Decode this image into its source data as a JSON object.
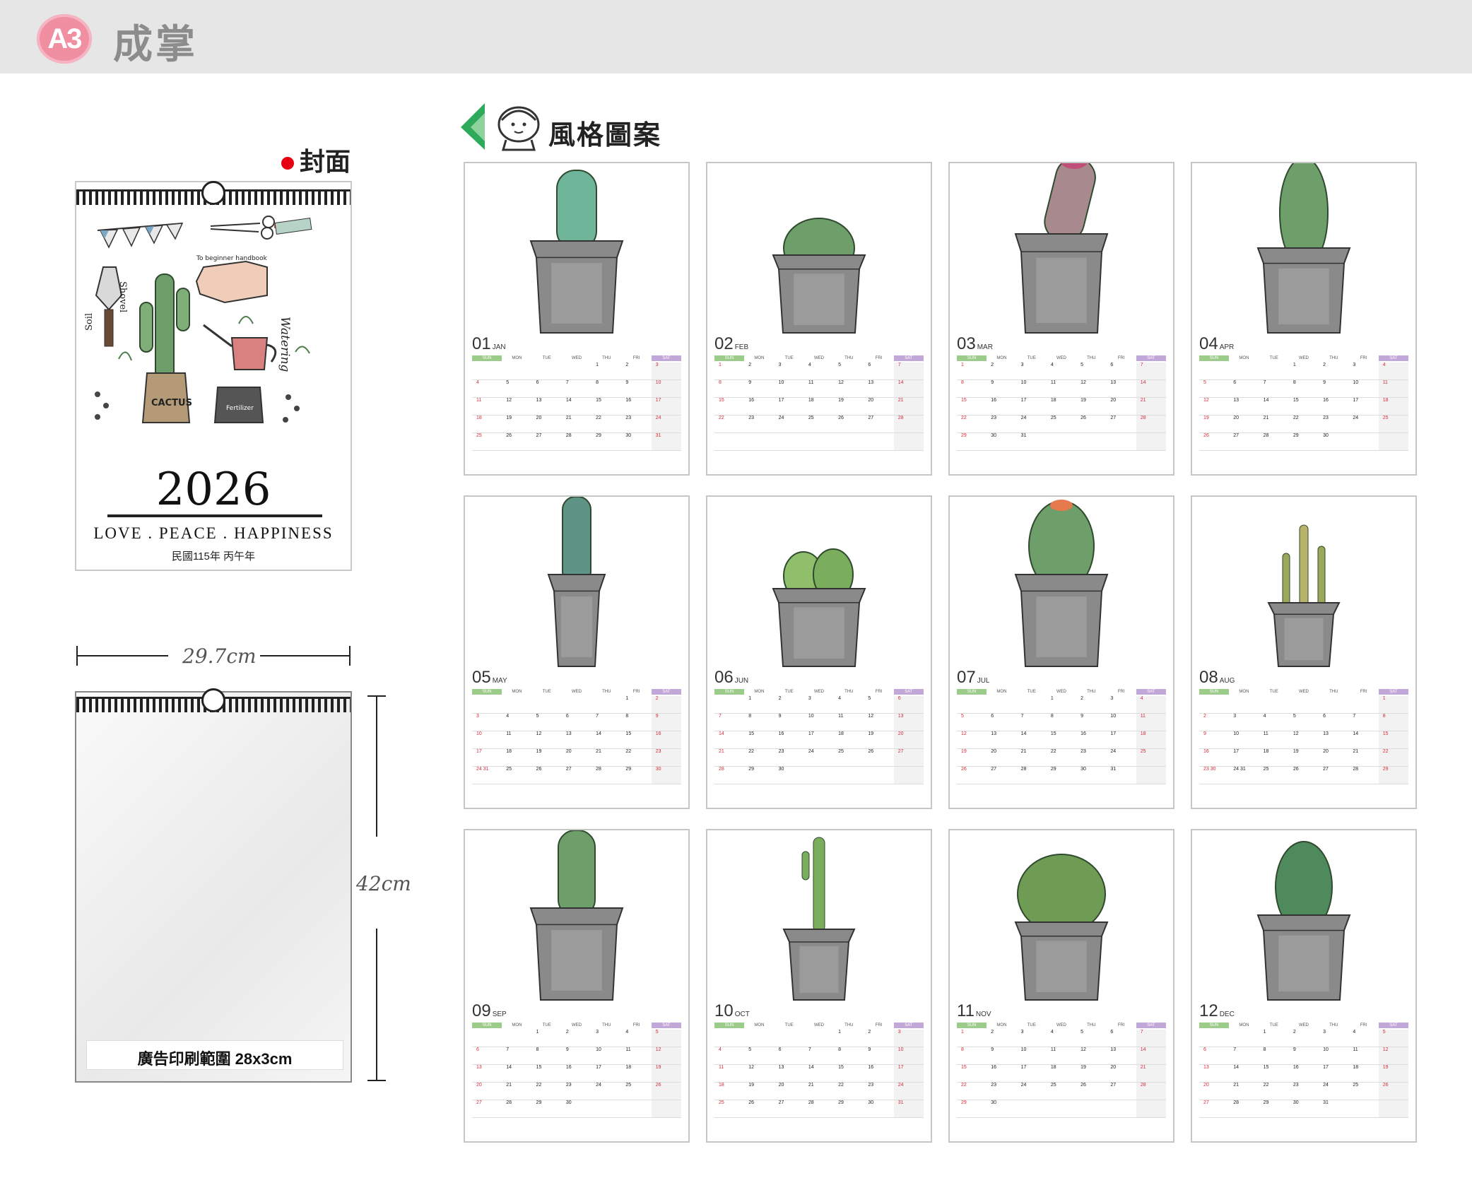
{
  "header": {
    "badge": "A3",
    "title": "成掌"
  },
  "cover": {
    "label": "封面",
    "year": "2026",
    "slogan": "LOVE . PEACE . HAPPINESS",
    "roc_year": "民國115年 丙午年",
    "doodles": [
      "To beginner handbook",
      "Shovel",
      "Soil",
      "Watering",
      "CACTUS",
      "Fertilizer"
    ]
  },
  "back": {
    "width_label": "29.7cm",
    "height_label": "42cm",
    "ad_area": "廣告印刷範圍 28x3cm"
  },
  "style_section": {
    "label": "風格圖案",
    "icon": "face-with-green-triangle-icon"
  },
  "colors": {
    "sun_header": "#9ccc8a",
    "sat_header": "#c1a8d8",
    "holiday_red": "#d62a3c",
    "pot_gray": "#7a7a7a",
    "cactus_green": "#6e9f6a"
  },
  "weekdays": [
    "SUN",
    "MON",
    "TUE",
    "WED",
    "THU",
    "FRI",
    "SAT"
  ],
  "months": [
    {
      "num": "01",
      "abbr": "JAN",
      "weeks": [
        [
          "",
          "",
          "",
          "",
          "1",
          "2",
          "3"
        ],
        [
          "4",
          "5",
          "6",
          "7",
          "8",
          "9",
          "10"
        ],
        [
          "11",
          "12",
          "13",
          "14",
          "15",
          "16",
          "17"
        ],
        [
          "18",
          "19",
          "20",
          "21",
          "22",
          "23",
          "24"
        ],
        [
          "25",
          "26",
          "27",
          "28",
          "29",
          "30",
          "31"
        ]
      ]
    },
    {
      "num": "02",
      "abbr": "FEB",
      "weeks": [
        [
          "1",
          "2",
          "3",
          "4",
          "5",
          "6",
          "7"
        ],
        [
          "8",
          "9",
          "10",
          "11",
          "12",
          "13",
          "14"
        ],
        [
          "15",
          "16",
          "17",
          "18",
          "19",
          "20",
          "21"
        ],
        [
          "22",
          "23",
          "24",
          "25",
          "26",
          "27",
          "28"
        ],
        [
          "",
          "",
          "",
          "",
          "",
          "",
          ""
        ]
      ]
    },
    {
      "num": "03",
      "abbr": "MAR",
      "weeks": [
        [
          "1",
          "2",
          "3",
          "4",
          "5",
          "6",
          "7"
        ],
        [
          "8",
          "9",
          "10",
          "11",
          "12",
          "13",
          "14"
        ],
        [
          "15",
          "16",
          "17",
          "18",
          "19",
          "20",
          "21"
        ],
        [
          "22",
          "23",
          "24",
          "25",
          "26",
          "27",
          "28"
        ],
        [
          "29",
          "30",
          "31",
          "",
          "",
          "",
          ""
        ]
      ]
    },
    {
      "num": "04",
      "abbr": "APR",
      "weeks": [
        [
          "",
          "",
          "",
          "1",
          "2",
          "3",
          "4"
        ],
        [
          "5",
          "6",
          "7",
          "8",
          "9",
          "10",
          "11"
        ],
        [
          "12",
          "13",
          "14",
          "15",
          "16",
          "17",
          "18"
        ],
        [
          "19",
          "20",
          "21",
          "22",
          "23",
          "24",
          "25"
        ],
        [
          "26",
          "27",
          "28",
          "29",
          "30",
          "",
          ""
        ]
      ]
    },
    {
      "num": "05",
      "abbr": "MAY",
      "weeks": [
        [
          "",
          "",
          "",
          "",
          "",
          "1",
          "2"
        ],
        [
          "3",
          "4",
          "5",
          "6",
          "7",
          "8",
          "9"
        ],
        [
          "10",
          "11",
          "12",
          "13",
          "14",
          "15",
          "16"
        ],
        [
          "17",
          "18",
          "19",
          "20",
          "21",
          "22",
          "23"
        ],
        [
          "24 31",
          "25",
          "26",
          "27",
          "28",
          "29",
          "30"
        ]
      ]
    },
    {
      "num": "06",
      "abbr": "JUN",
      "weeks": [
        [
          "",
          "1",
          "2",
          "3",
          "4",
          "5",
          "6"
        ],
        [
          "7",
          "8",
          "9",
          "10",
          "11",
          "12",
          "13"
        ],
        [
          "14",
          "15",
          "16",
          "17",
          "18",
          "19",
          "20"
        ],
        [
          "21",
          "22",
          "23",
          "24",
          "25",
          "26",
          "27"
        ],
        [
          "28",
          "29",
          "30",
          "",
          "",
          "",
          ""
        ]
      ]
    },
    {
      "num": "07",
      "abbr": "JUL",
      "weeks": [
        [
          "",
          "",
          "",
          "1",
          "2",
          "3",
          "4"
        ],
        [
          "5",
          "6",
          "7",
          "8",
          "9",
          "10",
          "11"
        ],
        [
          "12",
          "13",
          "14",
          "15",
          "16",
          "17",
          "18"
        ],
        [
          "19",
          "20",
          "21",
          "22",
          "23",
          "24",
          "25"
        ],
        [
          "26",
          "27",
          "28",
          "29",
          "30",
          "31",
          ""
        ]
      ]
    },
    {
      "num": "08",
      "abbr": "AUG",
      "weeks": [
        [
          "",
          "",
          "",
          "",
          "",
          "",
          "1"
        ],
        [
          "2",
          "3",
          "4",
          "5",
          "6",
          "7",
          "8"
        ],
        [
          "9",
          "10",
          "11",
          "12",
          "13",
          "14",
          "15"
        ],
        [
          "16",
          "17",
          "18",
          "19",
          "20",
          "21",
          "22"
        ],
        [
          "23 30",
          "24 31",
          "25",
          "26",
          "27",
          "28",
          "29"
        ]
      ]
    },
    {
      "num": "09",
      "abbr": "SEP",
      "weeks": [
        [
          "",
          "",
          "1",
          "2",
          "3",
          "4",
          "5"
        ],
        [
          "6",
          "7",
          "8",
          "9",
          "10",
          "11",
          "12"
        ],
        [
          "13",
          "14",
          "15",
          "16",
          "17",
          "18",
          "19"
        ],
        [
          "20",
          "21",
          "22",
          "23",
          "24",
          "25",
          "26"
        ],
        [
          "27",
          "28",
          "29",
          "30",
          "",
          "",
          ""
        ]
      ]
    },
    {
      "num": "10",
      "abbr": "OCT",
      "weeks": [
        [
          "",
          "",
          "",
          "",
          "1",
          "2",
          "3"
        ],
        [
          "4",
          "5",
          "6",
          "7",
          "8",
          "9",
          "10"
        ],
        [
          "11",
          "12",
          "13",
          "14",
          "15",
          "16",
          "17"
        ],
        [
          "18",
          "19",
          "20",
          "21",
          "22",
          "23",
          "24"
        ],
        [
          "25",
          "26",
          "27",
          "28",
          "29",
          "30",
          "31"
        ]
      ]
    },
    {
      "num": "11",
      "abbr": "NOV",
      "weeks": [
        [
          "1",
          "2",
          "3",
          "4",
          "5",
          "6",
          "7"
        ],
        [
          "8",
          "9",
          "10",
          "11",
          "12",
          "13",
          "14"
        ],
        [
          "15",
          "16",
          "17",
          "18",
          "19",
          "20",
          "21"
        ],
        [
          "22",
          "23",
          "24",
          "25",
          "26",
          "27",
          "28"
        ],
        [
          "29",
          "30",
          "",
          "",
          "",
          "",
          ""
        ]
      ]
    },
    {
      "num": "12",
      "abbr": "DEC",
      "weeks": [
        [
          "",
          "",
          "1",
          "2",
          "3",
          "4",
          "5"
        ],
        [
          "6",
          "7",
          "8",
          "9",
          "10",
          "11",
          "12"
        ],
        [
          "13",
          "14",
          "15",
          "16",
          "17",
          "18",
          "19"
        ],
        [
          "20",
          "21",
          "22",
          "23",
          "24",
          "25",
          "26"
        ],
        [
          "27",
          "28",
          "29",
          "30",
          "31",
          "",
          ""
        ]
      ]
    }
  ]
}
